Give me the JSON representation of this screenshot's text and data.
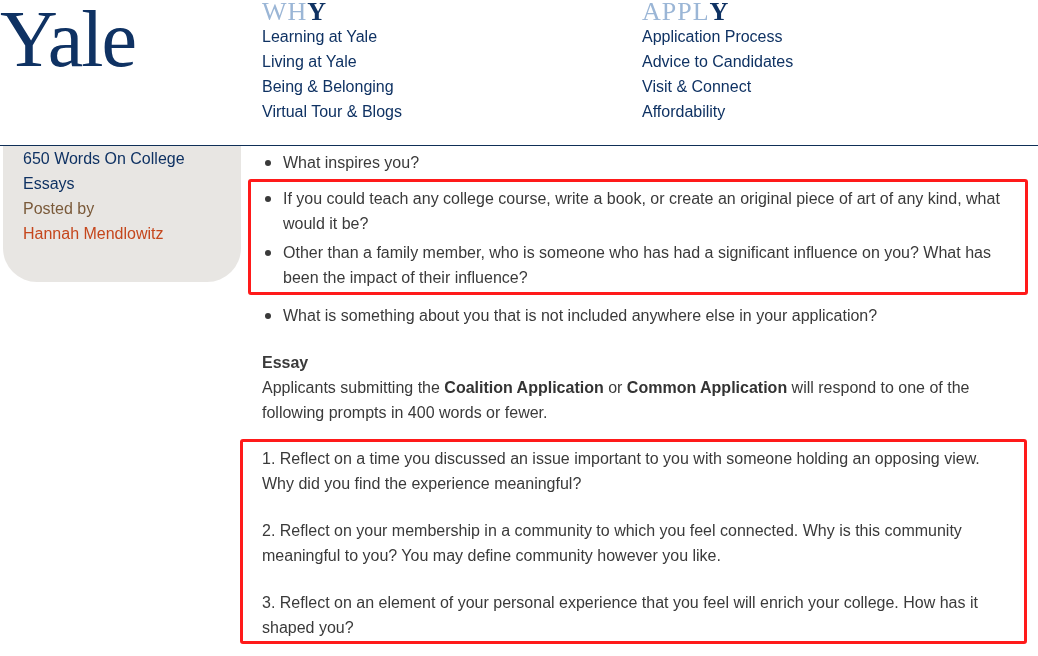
{
  "header": {
    "logo": "Yale",
    "nav_columns": [
      {
        "heading": "WH**Y**",
        "links": [
          "Learning at Yale",
          "Living at Yale",
          "Being & Belonging",
          "Virtual Tour & Blogs"
        ]
      },
      {
        "heading": "APPL**Y**",
        "links": [
          "Application Process",
          "Advice to Candidates",
          "Visit & Connect",
          "Affordability"
        ]
      }
    ]
  },
  "sidebar": {
    "post_title": "650 Words On College Essays",
    "byline": "Posted by",
    "author": "Hannah Mendlowitz"
  },
  "question_groups": [
    {
      "highlighted": false,
      "items": [
        "What inspires you?"
      ]
    },
    {
      "highlighted": true,
      "items": [
        "If you could teach any college course, write a book, or create an original piece of art of any kind, what would it be?",
        "Other than a family member, who is someone who has had a significant influence on you? What has been the impact of their influence?"
      ]
    },
    {
      "highlighted": false,
      "items": [
        "What is something about you that is not included anywhere else in your application?"
      ]
    }
  ],
  "essay": {
    "heading": "Essay",
    "intro": "Applicants submitting the **Coalition Application** or **Common Application** will respond to one of the following prompts in 400 words or fewer.",
    "prompts_highlighted": true,
    "prompts": [
      "1. Reflect on a time you discussed an issue important to you with someone holding an opposing view. Why did you find the experience meaningful?",
      "2. Reflect on your membership in a community to which you feel connected. Why is this community meaningful to you? You may define community however you like.",
      "3. Reflect on an element of your personal experience that you feel will enrich your college. How has it shaped you?"
    ]
  }
}
